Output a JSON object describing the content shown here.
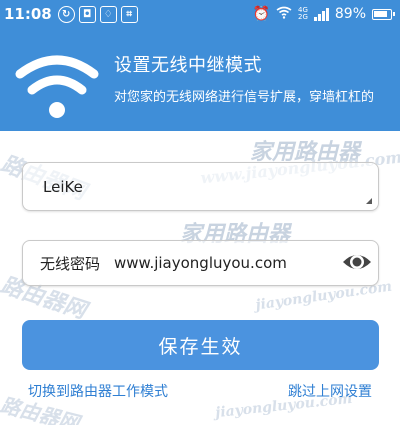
{
  "status_bar": {
    "time": "11:08",
    "network_top": "4G",
    "network_bottom": "2G",
    "battery_percent": "89%"
  },
  "header": {
    "title": "设置无线中继模式",
    "subtitle": "对您家的无线网络进行信号扩展，穿墙杠杠的"
  },
  "ssid_field": {
    "value": "LeiKe"
  },
  "password_field": {
    "label": "无线密码",
    "value": "www.jiayongluyou.com"
  },
  "save_button": {
    "label": "保存生效"
  },
  "links": {
    "switch_mode": "切换到路由器工作模式",
    "skip": "跳过上网设置"
  },
  "watermark": {
    "url": "www.jiayongluyou.com",
    "url_short": "jiayongluyou.com",
    "brand": "家用路由器",
    "brand_side": "路由器网"
  },
  "colors": {
    "primary": "#3f8ed8",
    "button": "#4b93df",
    "link": "#2f7fd3"
  }
}
